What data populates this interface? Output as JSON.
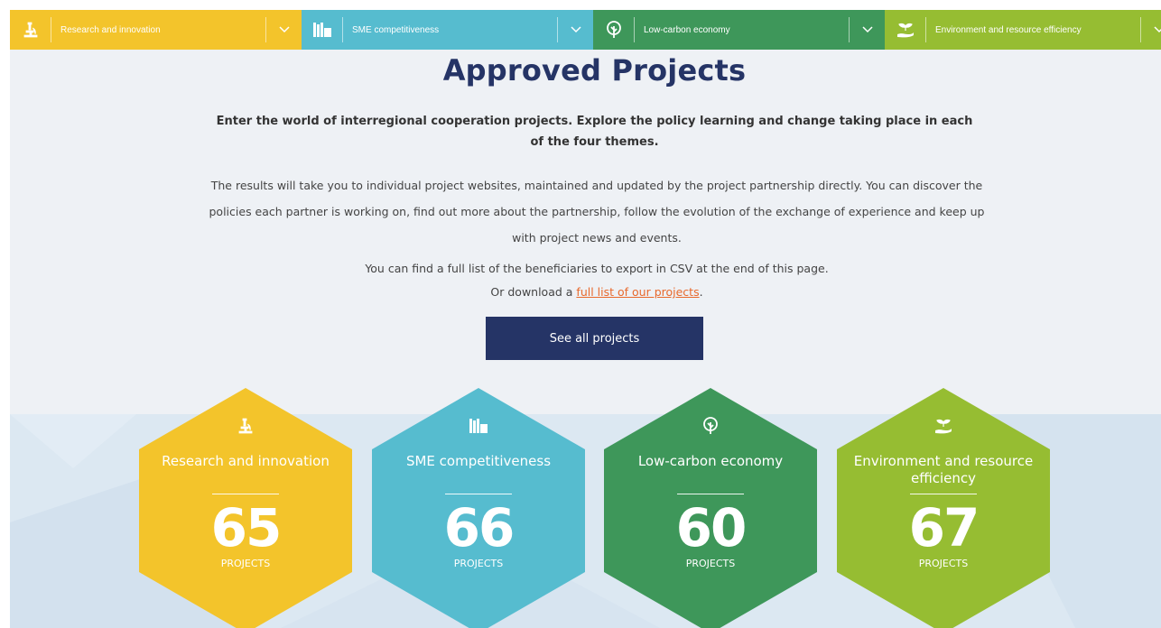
{
  "nav": {
    "tabs": [
      {
        "label": "Research and innovation",
        "icon": "microscope-icon",
        "color": "#f3c42b"
      },
      {
        "label": "SME competitiveness",
        "icon": "buildings-icon",
        "color": "#56bccf"
      },
      {
        "label": "Low-carbon economy",
        "icon": "tree-icon",
        "color": "#3e975a"
      },
      {
        "label": "Environment and resource efficiency",
        "icon": "sprout-hand-icon",
        "color": "#96bd32"
      }
    ]
  },
  "hero": {
    "title": "Approved Projects",
    "intro": "Enter the world of interregional cooperation projects. Explore the policy learning and change taking place in each of the four themes.",
    "body": "The results will take you to individual project websites, maintained and updated by the project partnership directly. You can discover the policies each partner is working on, find out more about the partnership, follow the evolution of the exchange of experience and keep up with project news and events.",
    "csv_line": "You can find a full list of the beneficiaries to export in CSV at the end of this page.",
    "download_prefix": "Or download a ",
    "download_link": "full list of our projects",
    "download_suffix": ".",
    "button": "See all projects"
  },
  "themes": [
    {
      "title": "Research and innovation",
      "count": "65",
      "unit": "PROJECTS",
      "color": "#f3c42b",
      "icon": "microscope-icon"
    },
    {
      "title": "SME competitiveness",
      "count": "66",
      "unit": "PROJECTS",
      "color": "#56bccf",
      "icon": "buildings-icon"
    },
    {
      "title": "Low-carbon economy",
      "count": "60",
      "unit": "PROJECTS",
      "color": "#3e975a",
      "icon": "tree-icon"
    },
    {
      "title": "Environment and resource efficiency",
      "count": "67",
      "unit": "PROJECTS",
      "color": "#96bd32",
      "icon": "sprout-hand-icon"
    }
  ],
  "colors": {
    "navy": "#253466",
    "link": "#e8692c",
    "background": "#eef1f5",
    "band": "#dce8f2"
  }
}
